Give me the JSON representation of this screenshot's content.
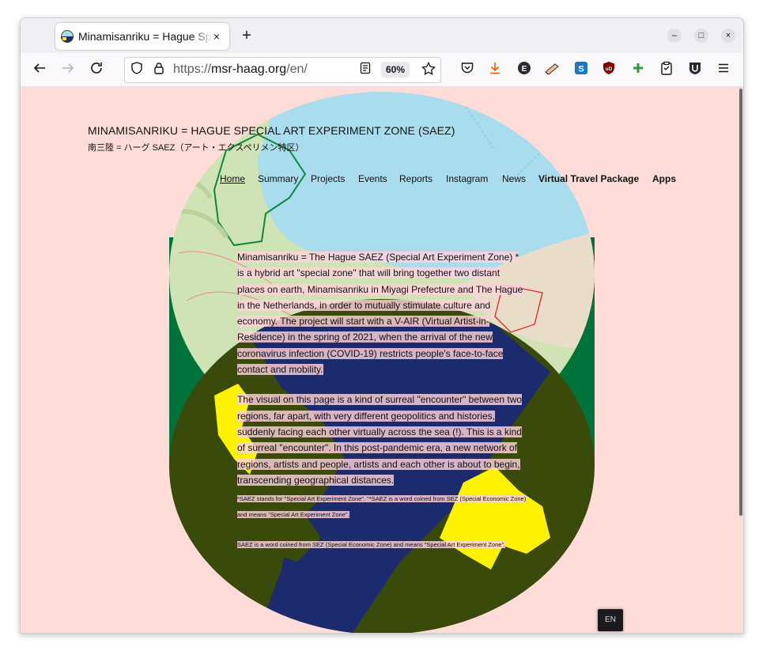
{
  "browser": {
    "tab_title": "Minamisanriku = Hague Special Art Experiment Zone (SAEZ)",
    "tab_close": "×",
    "new_tab": "+",
    "window_controls": {
      "minimize": "–",
      "maximize": "□",
      "close": "×"
    },
    "url_scheme": "https://",
    "url_host": "msr-haag.org",
    "url_path": "/en/",
    "zoom": "60%",
    "icons": {
      "back": "back-arrow-icon",
      "forward": "forward-arrow-icon",
      "reload": "reload-icon",
      "shield": "shield-icon",
      "lock": "lock-icon",
      "reader": "reader-view-icon",
      "bookmark": "star-icon",
      "pocket": "pocket-icon",
      "downloads": "download-icon",
      "menu": "hamburger-menu-icon"
    },
    "extensions": [
      "E",
      "✎",
      "S",
      "uD",
      "+",
      "📋",
      "U"
    ]
  },
  "page": {
    "site_title": "MINAMISANRIKU = HAGUE SPECIAL ART EXPERIMENT ZONE (SAEZ)",
    "site_subtitle": "南三陸 = ハーグ SAEZ（アート・エクスペリメン特区）",
    "nav": [
      {
        "label": "Home",
        "style": "active"
      },
      {
        "label": "Summary",
        "style": "normal"
      },
      {
        "label": "Projects",
        "style": "normal"
      },
      {
        "label": "Events",
        "style": "normal"
      },
      {
        "label": "Reports",
        "style": "normal"
      },
      {
        "label": "Instagram",
        "style": "normal"
      },
      {
        "label": "News",
        "style": "normal"
      },
      {
        "label": "Virtual Travel Package",
        "style": "bold"
      },
      {
        "label": "Apps",
        "style": "bold"
      }
    ],
    "paragraph1": "Minamisanriku = The Hague SAEZ (Special Art Experiment Zone) * is a hybrid art \"special zone\" that will bring together two distant places on earth, Minamisanriku in Miyagi Prefecture and The Hague in the Netherlands, in order to mutually stimulate culture and economy. The project will start with a V-AIR (Virtual Artist-in-Residence) in the spring of 2021, when the arrival of the new coronavirus infection (COVID-19) restricts people's face-to-face contact and mobility.",
    "paragraph2": "The visual on this page is a kind of surreal \"encounter\" between two regions, far apart, with very different geopolitics and histories, suddenly facing each other virtually across the sea (!). This is a kind of surreal \"encounter\". In this post-pandemic era, a new network of regions, artists and people, artists and each other is about to begin, transcending geographical distances.",
    "footnote1": "*SAEZ stands for \"Special Art Experiment Zone\". \"*SAEZ is a word coined from SEZ (Special Economic Zone) and means \"Special Art Experiment Zone\".",
    "footnote2": "SAEZ is a word coined from SEZ (Special Economic Zone) and means \"Special Art Experiment Zone\".",
    "language_switch": "EN",
    "colors": {
      "background": "#ffdcd8",
      "sea": "#a9dcec",
      "land": "#cfe3b4",
      "dark_green": "#00733a",
      "olive": "#3a4a0a",
      "navy": "#1c2a6e",
      "yellow": "#fff200"
    }
  }
}
